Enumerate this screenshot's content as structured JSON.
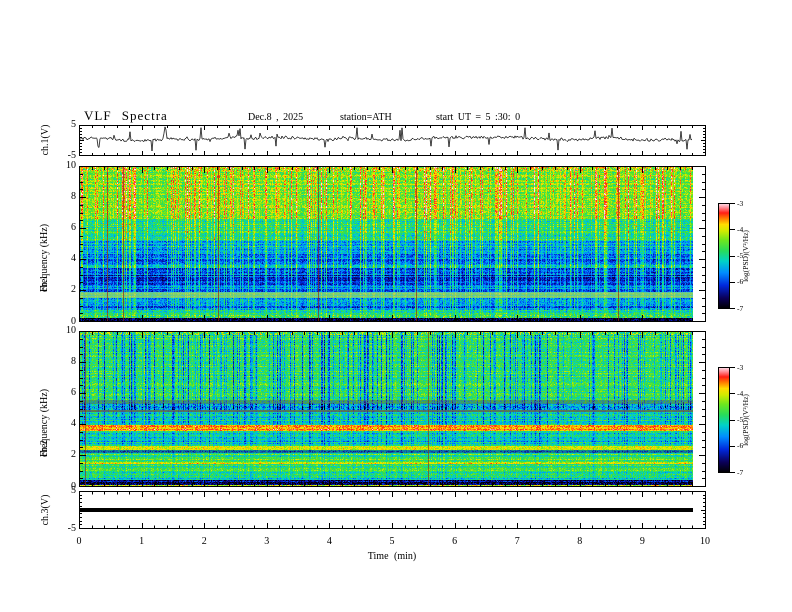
{
  "chart_data": {
    "type": "multi-panel",
    "title": "VLF  Spectra",
    "header": {
      "date": "Dec.8 , 2025",
      "station": "station=ATH",
      "start_ut": "start UT =  5 :30: 0"
    },
    "x_axis": {
      "label": "Time  (min)",
      "min": 0,
      "max": 10,
      "ticks": [
        0,
        1,
        2,
        3,
        4,
        5,
        6,
        7,
        8,
        9,
        10
      ],
      "minor_step": 0.2,
      "data_end_min": 9.8
    },
    "colorbar": {
      "label": "log(PSD)(V²/Hz)",
      "ticks": [
        -3,
        -4,
        -5,
        -6,
        -7
      ],
      "max": -3,
      "min": -7,
      "colormap_stops": [
        [
          0.0,
          0,
          0,
          0
        ],
        [
          0.1,
          10,
          0,
          90
        ],
        [
          0.22,
          0,
          40,
          220
        ],
        [
          0.34,
          0,
          140,
          255
        ],
        [
          0.45,
          0,
          210,
          200
        ],
        [
          0.55,
          40,
          220,
          90
        ],
        [
          0.65,
          110,
          230,
          30
        ],
        [
          0.74,
          210,
          235,
          0
        ],
        [
          0.8,
          255,
          220,
          0
        ],
        [
          0.86,
          255,
          120,
          0
        ],
        [
          0.91,
          255,
          30,
          20
        ],
        [
          0.96,
          255,
          140,
          150
        ],
        [
          1.0,
          255,
          225,
          235
        ]
      ]
    },
    "panels": [
      {
        "id": "wave1",
        "type": "line",
        "ylabel": "ch.1(V)",
        "ylim": [
          -5,
          5
        ],
        "yticks": [
          5,
          -5
        ],
        "signal": {
          "baseline": 0.45,
          "noise": 0.45,
          "wander": 0.55,
          "spike_prob": 0.08,
          "spike_min": 0.8,
          "spike_max": 4.2,
          "seed": 5
        }
      },
      {
        "id": "spec1",
        "type": "heatmap",
        "ylabel_line1": "ch.1",
        "ylabel_line2": "Frequency  (kHz)",
        "ylim": [
          0,
          10
        ],
        "yticks": [
          10,
          8,
          6,
          4,
          2,
          0
        ],
        "seed": 13,
        "streaks": {
          "prob": 0.32,
          "strength_min": 0.35,
          "full_line_prob": 0.012,
          "full_line_color": [
            150,
            30,
            10
          ]
        },
        "bands": [
          {
            "f0": 9.7,
            "f1": 10.01,
            "base": 0.68,
            "noise": 0.18,
            "streak": 0.25,
            "hstripe": 0.02
          },
          {
            "f0": 6.6,
            "f1": 9.7,
            "base": 0.62,
            "noise": 0.1,
            "streak": 0.3,
            "hstripe": 0.05
          },
          {
            "f0": 5.2,
            "f1": 6.6,
            "base": 0.5,
            "noise": 0.1,
            "streak": 0.28,
            "hstripe": 0.06
          },
          {
            "f0": 4.4,
            "f1": 5.2,
            "base": 0.36,
            "noise": 0.09,
            "streak": 0.3,
            "hstripe": 0.08
          },
          {
            "f0": 3.1,
            "f1": 4.4,
            "base": 0.3,
            "noise": 0.09,
            "streak": 0.32,
            "hstripe": 0.09
          },
          {
            "f0": 2.35,
            "f1": 3.1,
            "base": 0.22,
            "noise": 0.08,
            "streak": 0.28,
            "hstripe": 0.08
          },
          {
            "f0": 1.95,
            "f1": 2.35,
            "base": 0.3,
            "noise": 0.08,
            "streak": 0.22,
            "hstripe": 0.06
          },
          {
            "f0": 1.55,
            "f1": 1.95,
            "base": 0.55,
            "noise": 0.07,
            "streak": 0.1,
            "hstripe": 0.05,
            "color": [
              175,
              185,
              175
            ],
            "mix": 0.45
          },
          {
            "f0": 1.05,
            "f1": 1.55,
            "base": 0.33,
            "noise": 0.09,
            "streak": 0.22,
            "hstripe": 0.07
          },
          {
            "f0": 0.75,
            "f1": 1.05,
            "base": 0.28,
            "noise": 0.09,
            "streak": 0.22,
            "hstripe": 0.06
          },
          {
            "f0": 0.42,
            "f1": 0.75,
            "base": 0.5,
            "noise": 0.1,
            "streak": 0.12,
            "hstripe": 0.05
          },
          {
            "f0": 0.25,
            "f1": 0.42,
            "base": 0.55,
            "noise": 0.15,
            "streak": 0.1,
            "hstripe": 0.03
          },
          {
            "f0": -0.01,
            "f1": 0.25,
            "base": 0.05,
            "noise": 0.1,
            "streak": 0.05,
            "hstripe": 0.02
          }
        ]
      },
      {
        "id": "spec2",
        "type": "heatmap",
        "ylabel_line1": "ch.2",
        "ylabel_line2": "Frequency  (kHz)",
        "ylim": [
          0,
          10
        ],
        "yticks": [
          10,
          8,
          6,
          4,
          2,
          0
        ],
        "seed": 29,
        "streaks": {
          "prob": 0.3,
          "strength_min": 0.35,
          "full_line_prob": 0.01,
          "full_line_color": [
            140,
            50,
            15
          ]
        },
        "bands": [
          {
            "f0": 9.75,
            "f1": 10.01,
            "base": 0.62,
            "noise": 0.2,
            "streak": -0.15,
            "hstripe": 0.02
          },
          {
            "f0": 5.55,
            "f1": 9.75,
            "base": 0.58,
            "noise": 0.1,
            "streak": -0.32,
            "hstripe": 0.05
          },
          {
            "f0": 5.35,
            "f1": 5.55,
            "base": 0.52,
            "noise": 0.12,
            "streak": -0.25,
            "hstripe": 0.05,
            "color": [
              120,
              60,
              30
            ],
            "mix": 0.35
          },
          {
            "f0": 4.95,
            "f1": 5.35,
            "base": 0.42,
            "noise": 0.13,
            "streak": -0.28,
            "hstripe": 0.07
          },
          {
            "f0": 4.78,
            "f1": 4.95,
            "base": 0.5,
            "noise": 0.1,
            "streak": -0.1,
            "hstripe": 0.04,
            "color": [
              140,
              55,
              25
            ],
            "mix": 0.55
          },
          {
            "f0": 4.0,
            "f1": 4.78,
            "base": 0.5,
            "noise": 0.1,
            "streak": -0.18,
            "hstripe": 0.06
          },
          {
            "f0": 3.62,
            "f1": 4.0,
            "base": 0.84,
            "noise": 0.07,
            "streak": 0.05,
            "hstripe": 0.04
          },
          {
            "f0": 2.62,
            "f1": 3.62,
            "base": 0.47,
            "noise": 0.09,
            "streak": -0.15,
            "hstripe": 0.07
          },
          {
            "f0": 2.35,
            "f1": 2.62,
            "base": 0.7,
            "noise": 0.08,
            "streak": 0.0,
            "hstripe": 0.05
          },
          {
            "f0": 2.15,
            "f1": 2.35,
            "base": 0.38,
            "noise": 0.12,
            "streak": -0.1,
            "hstripe": 0.1,
            "color": [
              40,
              40,
              30
            ],
            "mix": 0.35
          },
          {
            "f0": 1.62,
            "f1": 2.15,
            "base": 0.58,
            "noise": 0.09,
            "streak": -0.08,
            "hstripe": 0.07
          },
          {
            "f0": 1.5,
            "f1": 1.62,
            "base": 0.76,
            "noise": 0.09,
            "streak": 0.0,
            "hstripe": 0.04
          },
          {
            "f0": 0.95,
            "f1": 1.5,
            "base": 0.56,
            "noise": 0.09,
            "streak": -0.08,
            "hstripe": 0.07
          },
          {
            "f0": 0.45,
            "f1": 0.95,
            "base": 0.54,
            "noise": 0.1,
            "streak": -0.08,
            "hstripe": 0.1
          },
          {
            "f0": 0.14,
            "f1": 0.45,
            "base": 0.14,
            "noise": 0.12,
            "streak": 0.0,
            "hstripe": 0.08
          },
          {
            "f0": -0.01,
            "f1": 0.14,
            "base": 0.7,
            "noise": 0.15,
            "streak": 0.0,
            "hstripe": 0.03
          }
        ]
      },
      {
        "id": "wave3",
        "type": "flatline",
        "ylabel": "ch.3(V)",
        "ylim": [
          -5,
          5
        ],
        "yticks": [
          5,
          -5
        ],
        "value": 0,
        "thickness_px": 4
      }
    ]
  }
}
